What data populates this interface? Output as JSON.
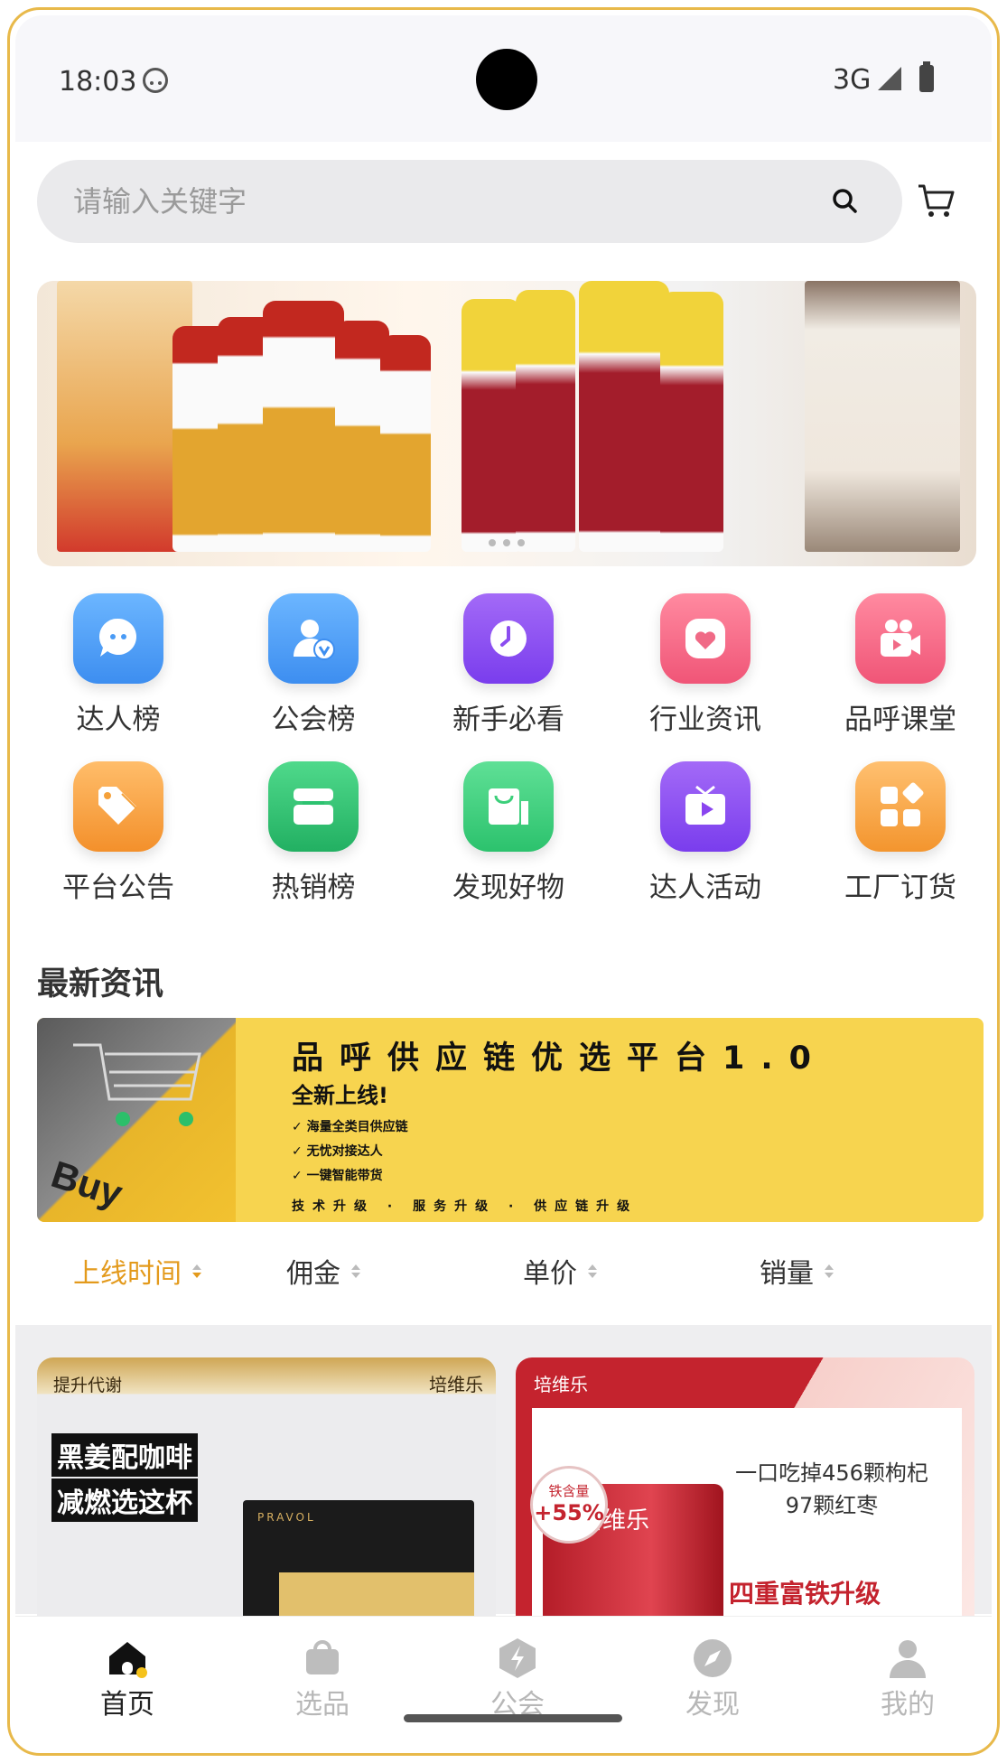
{
  "status_bar": {
    "time": "18:03",
    "network": "3G"
  },
  "search": {
    "placeholder": "请输入关键字"
  },
  "grid": [
    {
      "label": "达人榜",
      "icon": "chat-bubble-icon",
      "color": "#4a9bf5"
    },
    {
      "label": "公会榜",
      "icon": "verified-user-icon",
      "color": "#4a9bf5"
    },
    {
      "label": "新手必看",
      "icon": "clock-icon",
      "color": "#8b4df0"
    },
    {
      "label": "行业资讯",
      "icon": "heart-icon",
      "color": "#f06a86"
    },
    {
      "label": "品呼课堂",
      "icon": "video-camera-icon",
      "color": "#f06a86"
    },
    {
      "label": "平台公告",
      "icon": "tag-icon",
      "color": "#f5a13a"
    },
    {
      "label": "热销榜",
      "icon": "store-icon",
      "color": "#2dc270"
    },
    {
      "label": "发现好物",
      "icon": "shopping-bag-icon",
      "color": "#3ccf7a"
    },
    {
      "label": "达人活动",
      "icon": "tv-play-icon",
      "color": "#8a45ef"
    },
    {
      "label": "工厂订货",
      "icon": "apps-icon",
      "color": "#f7a63c"
    }
  ],
  "news": {
    "section_title": "最新资讯",
    "title": "品呼供应链优选平台1.0",
    "subtitle": "全新上线!",
    "points": [
      "✓ 海量全类目供应链",
      "✓ 无忧对接达人",
      "✓ 一键智能带货"
    ],
    "footer": "技术升级 · 服务升级 · 供应链升级",
    "image_text": "Buy"
  },
  "sort": {
    "items": [
      "上线时间",
      "佣金",
      "单价",
      "销量"
    ],
    "active_color": "#e39a1c"
  },
  "products": [
    {
      "tag": "提升代谢",
      "brand": "培维乐",
      "line1": "黑姜配咖啡",
      "line2": "减燃选这杯",
      "package": "PRAVOL"
    },
    {
      "brand": "培维乐",
      "quote_line1": "一口吃掉456颗枸杞",
      "quote_line2": "97颗红枣",
      "badge_label": "铁含量",
      "badge_value": "+55%",
      "feature": "四重富铁升级",
      "can_brand": "培维乐"
    }
  ],
  "tabbar": [
    {
      "label": "首页",
      "icon": "home-icon",
      "active": true
    },
    {
      "label": "选品",
      "icon": "shopping-bag-icon",
      "active": false
    },
    {
      "label": "公会",
      "icon": "guild-bolt-icon",
      "active": false
    },
    {
      "label": "发现",
      "icon": "compass-icon",
      "active": false
    },
    {
      "label": "我的",
      "icon": "user-icon",
      "active": false
    }
  ]
}
